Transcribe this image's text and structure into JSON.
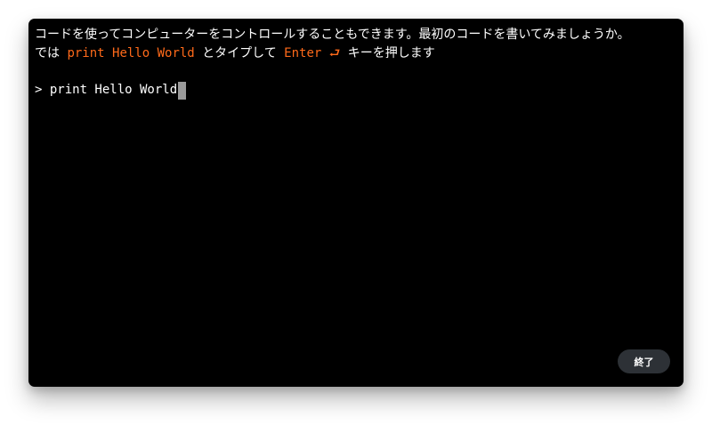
{
  "instructions": {
    "line1": "コードを使ってコンピューターをコントロールすることもできます。最初のコードを書いてみましょうか。",
    "line2_prefix": "では ",
    "line2_code": "print Hello World",
    "line2_middle": " とタイプして ",
    "line2_key": "Enter ⮐",
    "line2_suffix": " キーを押します"
  },
  "terminal": {
    "prompt": "> ",
    "input_value": "print Hello World"
  },
  "end_button": {
    "label": "終了"
  },
  "colors": {
    "background": "#000000",
    "text": "#ffffff",
    "highlight": "#ff6a1a",
    "button_bg": "#2d3136",
    "cursor": "#9a9a9a"
  }
}
